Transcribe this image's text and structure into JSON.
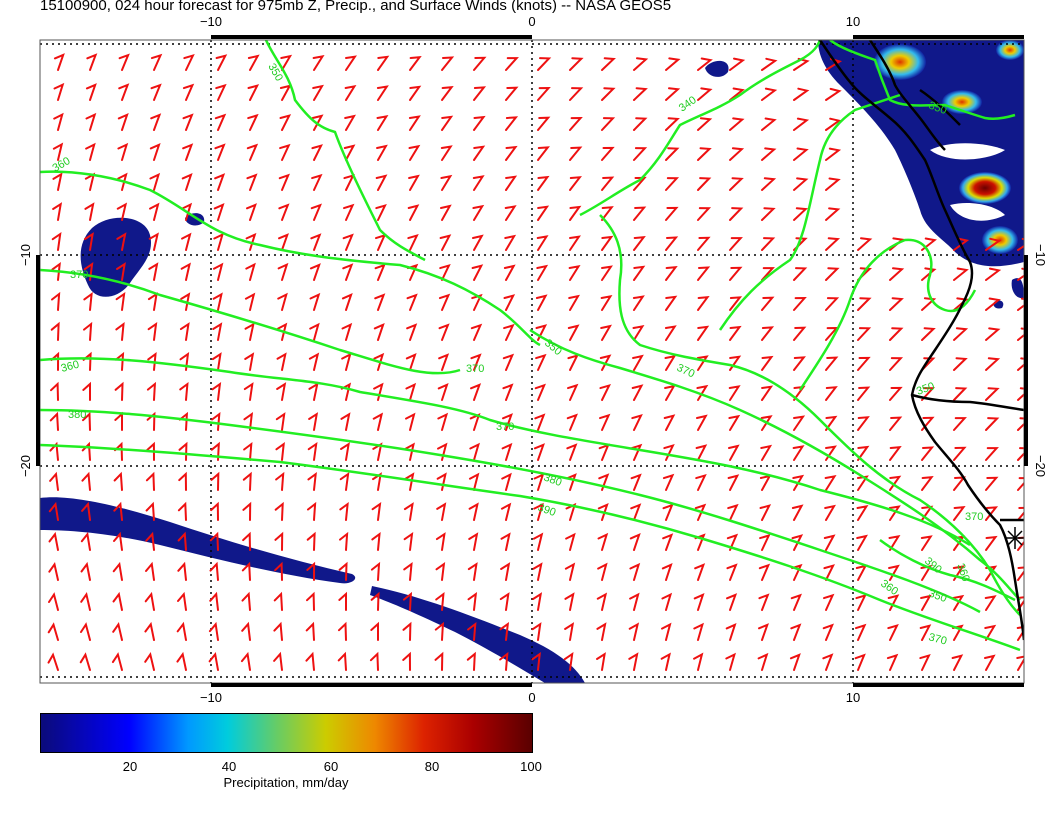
{
  "title": "15100900, 024 hour forecast for 975mb Z, Precip., and Surface Winds (knots) -- NASA GEOS5",
  "axes": {
    "top_ticks": [
      "−10",
      "0",
      "10"
    ],
    "bottom_ticks": [
      "−10",
      "0",
      "10"
    ],
    "left_ticks": [
      "−10",
      "−20"
    ],
    "right_ticks": [
      "−10",
      "−20"
    ]
  },
  "contour_labels": [
    "350",
    "340",
    "350",
    "360",
    "370",
    "350",
    "360",
    "370",
    "380",
    "370",
    "350",
    "390",
    "370",
    "360",
    "380",
    "390",
    "360",
    "350",
    "370",
    "370",
    "380",
    "360"
  ],
  "colorbar": {
    "ticks": [
      "20",
      "40",
      "60",
      "80",
      "100"
    ],
    "label": "Precipitation, mm/day",
    "colors": [
      "#0b0b7a",
      "#0000ff",
      "#00ccdd",
      "#cccc00",
      "#dd2200",
      "#5a0000"
    ]
  },
  "colors": {
    "wind_barbs": "#ee1111",
    "contours": "#22ee22",
    "coastline": "#000000",
    "precip_low": "#10188a"
  }
}
